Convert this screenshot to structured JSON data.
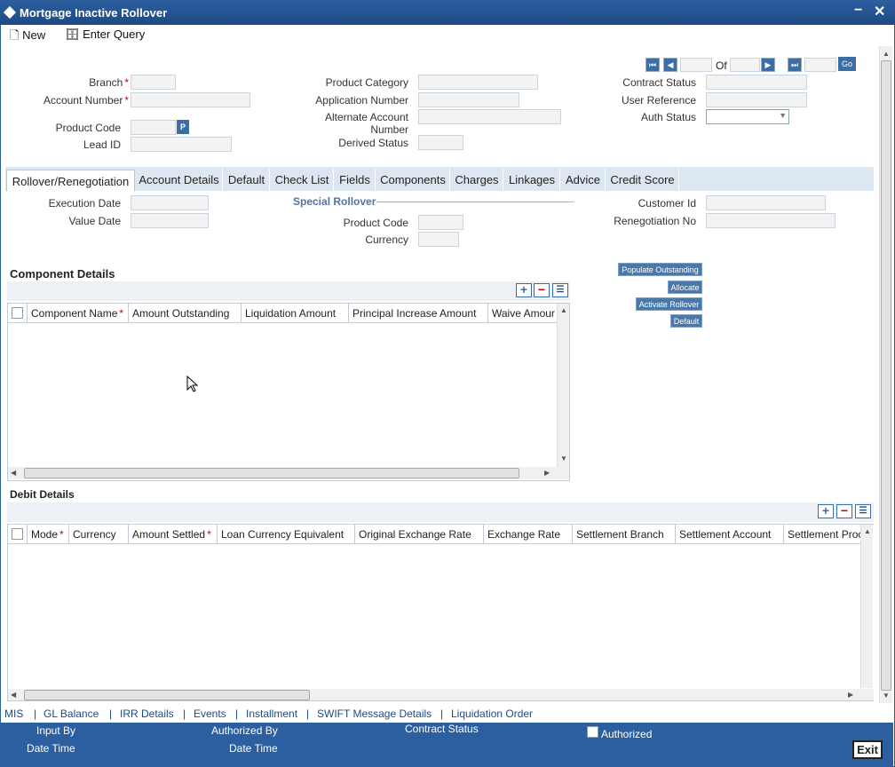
{
  "window": {
    "title": "Mortgage Inactive Rollover",
    "minimize": "−",
    "close": "✕"
  },
  "toolbar": {
    "new_label": "New",
    "enter_query_label": "Enter Query"
  },
  "header": {
    "branch_label": "Branch",
    "account_number_label": "Account Number",
    "product_code_label": "Product Code",
    "p_button": "P",
    "lead_id_label": "Lead ID",
    "product_category_label": "Product Category",
    "application_number_label": "Application Number",
    "alternate_account_label": "Alternate Account Number",
    "derived_status_label": "Derived Status",
    "contract_status_label": "Contract Status",
    "user_reference_label": "User Reference",
    "auth_status_label": "Auth Status",
    "of_label": "Of",
    "go_label": "Go"
  },
  "tabs": [
    "Rollover/Renegotiation",
    "Account Details",
    "Default",
    "Check List",
    "Fields",
    "Components",
    "Charges",
    "Linkages",
    "Advice",
    "Credit Score"
  ],
  "rollover": {
    "execution_date_label": "Execution Date",
    "value_date_label": "Value Date",
    "special_rollover_label": "Special Rollover",
    "product_code_label": "Product Code",
    "currency_label": "Currency",
    "customer_id_label": "Customer Id",
    "renegotiation_no_label": "Renegotiation No"
  },
  "component_details": {
    "title": "Component Details",
    "columns": [
      "Component Name",
      "Amount Outstanding",
      "Liquidation Amount",
      "Principal Increase Amount",
      "Waive Amour"
    ]
  },
  "side_buttons": [
    "Populate Outstanding",
    "Allocate",
    "Activate Rollover",
    "Default"
  ],
  "debit_details": {
    "title": "Debit Details",
    "columns": [
      "Mode",
      "Currency",
      "Amount Settled",
      "Loan Currency Equivalent",
      "Original Exchange Rate",
      "Exchange Rate",
      "Settlement Branch",
      "Settlement Account",
      "Settlement Proc"
    ]
  },
  "links": [
    "MIS",
    "GL Balance",
    "IRR Details",
    "Events",
    "Installment",
    "SWIFT Message Details",
    "Liquidation Order"
  ],
  "footer": {
    "input_by": "Input By",
    "date_time_1": "Date Time",
    "authorized_by": "Authorized By",
    "date_time_2": "Date Time",
    "contract_status": "Contract Status",
    "authorized": "Authorized",
    "exit": "Exit"
  }
}
